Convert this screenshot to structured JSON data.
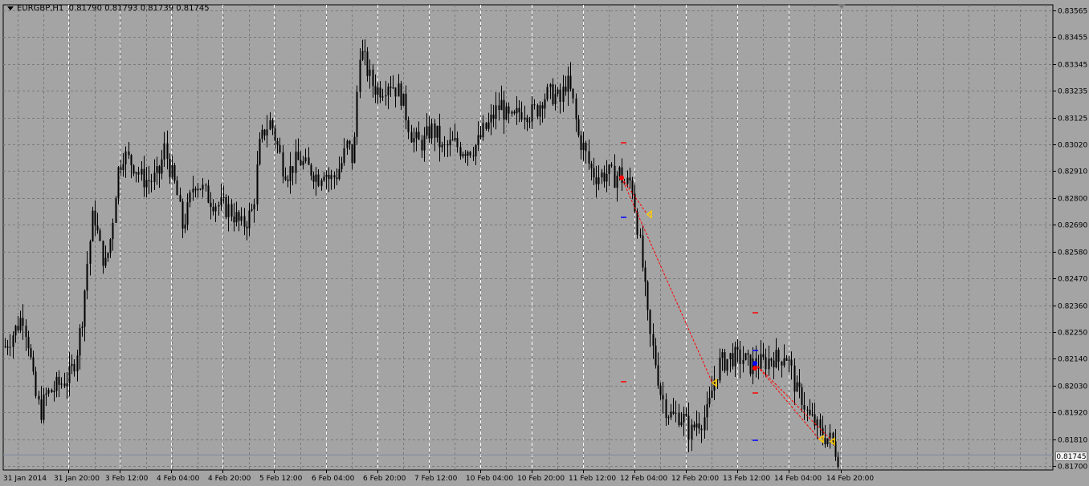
{
  "window": {
    "symbol_timeframe": "EURGBP,H1",
    "ohlc": "0.81790 0.81793 0.81739 0.81745",
    "current_price": "0.81745"
  },
  "colors": {
    "background": "#a4a4a4",
    "grid": "#7a7a7a",
    "date_grid": "#ffffff",
    "candle": "#000000",
    "trade_line": "#ff0000",
    "marker_red": "#ff0000",
    "marker_blue": "#0000ff",
    "arrow_yellow": "#ffcc00"
  },
  "chart_data": {
    "type": "candlestick",
    "ylim": [
      0.817,
      0.8357
    ],
    "y_ticks": [
      "0.83565",
      "0.83455",
      "0.83345",
      "0.83235",
      "0.83125",
      "0.83020",
      "0.82910",
      "0.82800",
      "0.82690",
      "0.82580",
      "0.82470",
      "0.82360",
      "0.82250",
      "0.82140",
      "0.82030",
      "0.81920",
      "0.81810",
      "0.81700"
    ],
    "x_ticks": [
      "31 Jan 2014",
      "31 Jan 20:00",
      "3 Feb 12:00",
      "4 Feb 04:00",
      "4 Feb 20:00",
      "5 Feb 12:00",
      "6 Feb 04:00",
      "6 Feb 20:00",
      "7 Feb 12:00",
      "10 Feb 04:00",
      "10 Feb 20:00",
      "11 Feb 12:00",
      "12 Feb 04:00",
      "12 Feb 20:00",
      "13 Feb 12:00",
      "14 Feb 04:00",
      "14 Feb 20:00"
    ],
    "price_path": [
      0.8219,
      0.8223,
      0.8227,
      0.8232,
      0.822,
      0.82,
      0.8192,
      0.8199,
      0.8201,
      0.8203,
      0.8205,
      0.8207,
      0.8215,
      0.823,
      0.8255,
      0.8275,
      0.826,
      0.8252,
      0.8265,
      0.829,
      0.8298,
      0.8295,
      0.8293,
      0.8288,
      0.8287,
      0.8287,
      0.8289,
      0.83,
      0.8291,
      0.8283,
      0.8268,
      0.8275,
      0.8287,
      0.8285,
      0.8281,
      0.8279,
      0.8277,
      0.8276,
      0.8275,
      0.8272,
      0.8268,
      0.8271,
      0.8275,
      0.83,
      0.8308,
      0.8311,
      0.8302,
      0.8293,
      0.829,
      0.8294,
      0.8295,
      0.8292,
      0.8291,
      0.8288,
      0.8292,
      0.8287,
      0.8289,
      0.8294,
      0.8302,
      0.8294,
      0.8341,
      0.8335,
      0.8327,
      0.8324,
      0.8325,
      0.8328,
      0.8325,
      0.8322,
      0.8313,
      0.8304,
      0.8302,
      0.8303,
      0.8308,
      0.8306,
      0.8299,
      0.8301,
      0.8302,
      0.83,
      0.83,
      0.83,
      0.8302,
      0.8307,
      0.831,
      0.8315,
      0.8318,
      0.8312,
      0.8311,
      0.8315,
      0.8316,
      0.8314,
      0.8316,
      0.8321,
      0.8322,
      0.8322,
      0.8319,
      0.8328,
      0.8321,
      0.8305,
      0.83,
      0.8292,
      0.8289,
      0.8289,
      0.829,
      0.8288,
      0.829,
      0.8285,
      0.8287,
      0.827,
      0.825,
      0.8225,
      0.8214,
      0.82,
      0.8193,
      0.819,
      0.8191,
      0.8189,
      0.8183,
      0.8188,
      0.8189,
      0.8192,
      0.8205,
      0.8212,
      0.8213,
      0.8215,
      0.8214,
      0.8214,
      0.8211,
      0.8212,
      0.8212,
      0.8213,
      0.8215,
      0.8213,
      0.8217,
      0.821,
      0.82,
      0.8198,
      0.819,
      0.8188,
      0.8183,
      0.8182,
      0.818,
      0.8174
    ]
  },
  "trades": [
    {
      "open_price": 0.8288,
      "close_price": 0.8273,
      "close_price_2": 0.8204
    },
    {
      "open_price": 0.8212,
      "close_price": 0.8181
    }
  ]
}
